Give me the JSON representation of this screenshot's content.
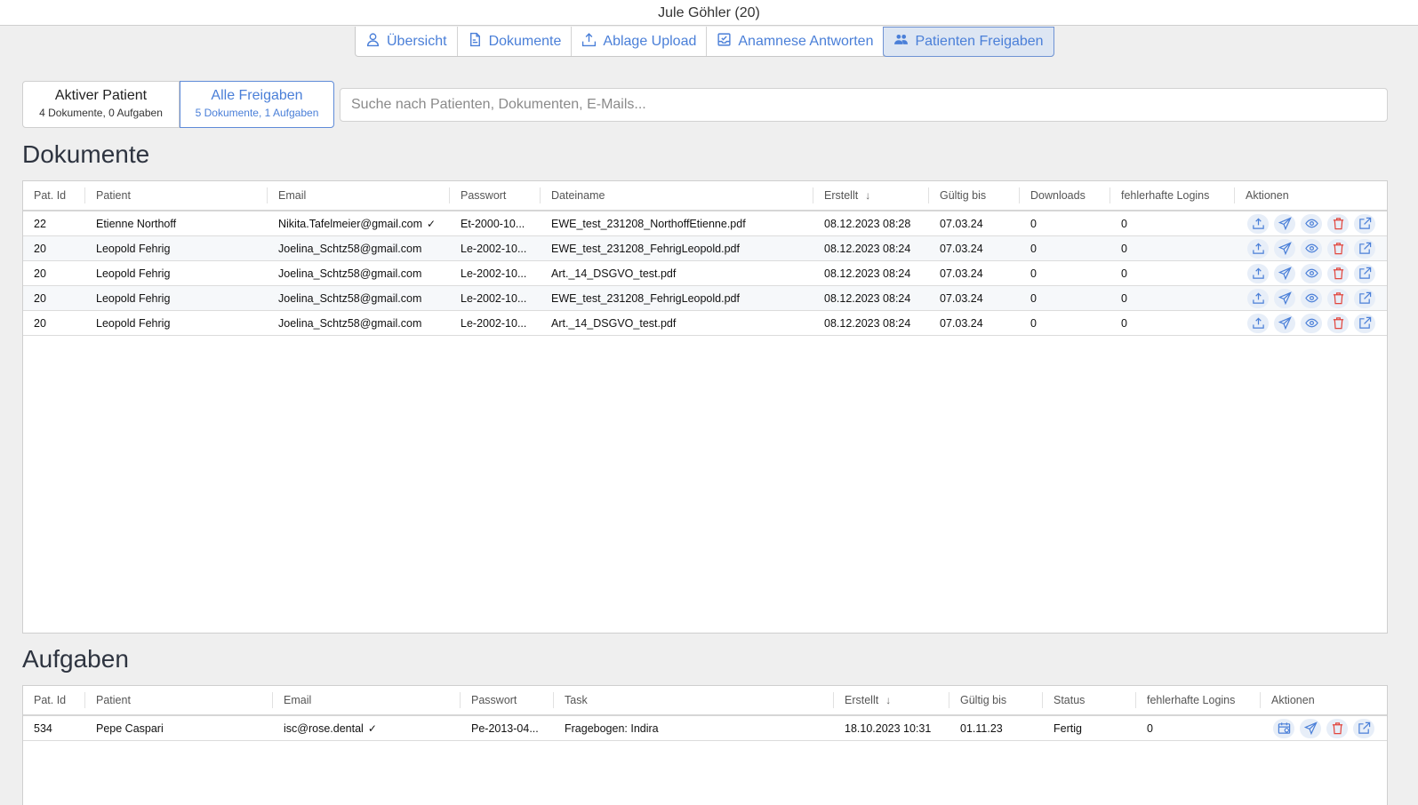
{
  "window": {
    "title": "Jule Göhler (20)"
  },
  "nav": {
    "tabs": [
      {
        "label": "Übersicht",
        "icon": "user-icon"
      },
      {
        "label": "Dokumente",
        "icon": "document-icon"
      },
      {
        "label": "Ablage Upload",
        "icon": "upload-icon"
      },
      {
        "label": "Anamnese Antworten",
        "icon": "inbox-icon"
      },
      {
        "label": "Patienten Freigaben",
        "icon": "users-icon",
        "active": true
      }
    ]
  },
  "scope": {
    "active_patient": {
      "title": "Aktiver Patient",
      "subtitle": "4 Dokumente, 0 Aufgaben"
    },
    "all_shares": {
      "title": "Alle Freigaben",
      "subtitle": "5 Dokumente, 1 Aufgaben",
      "selected": true
    }
  },
  "search": {
    "placeholder": "Suche nach Patienten, Dokumenten, E-Mails...",
    "value": ""
  },
  "documents": {
    "title": "Dokumente",
    "columns": [
      "Pat. Id",
      "Patient",
      "Email",
      "Passwort",
      "Dateiname",
      "Erstellt",
      "Gültig bis",
      "Downloads",
      "fehlerhafte Logins",
      "Aktionen"
    ],
    "sort_column": "Erstellt",
    "sort_direction": "descending",
    "rows": [
      {
        "pat_id": "22",
        "patient": "Etienne Northoff",
        "email": "Nikita.Tafelmeier@gmail.com",
        "verified": true,
        "password": "Et-2000-10...",
        "filename": "EWE_test_231208_NorthoffEtienne.pdf",
        "created": "08.12.2023 08:28",
        "valid_until": "07.03.24",
        "downloads": "0",
        "failed_logins": "0"
      },
      {
        "pat_id": "20",
        "patient": "Leopold Fehrig",
        "email": "Joelina_Schtz58@gmail.com",
        "verified": false,
        "password": "Le-2002-10...",
        "filename": "EWE_test_231208_FehrigLeopold.pdf",
        "created": "08.12.2023 08:24",
        "valid_until": "07.03.24",
        "downloads": "0",
        "failed_logins": "0"
      },
      {
        "pat_id": "20",
        "patient": "Leopold Fehrig",
        "email": "Joelina_Schtz58@gmail.com",
        "verified": false,
        "password": "Le-2002-10...",
        "filename": "Art._14_DSGVO_test.pdf",
        "created": "08.12.2023 08:24",
        "valid_until": "07.03.24",
        "downloads": "0",
        "failed_logins": "0"
      },
      {
        "pat_id": "20",
        "patient": "Leopold Fehrig",
        "email": "Joelina_Schtz58@gmail.com",
        "verified": false,
        "password": "Le-2002-10...",
        "filename": "EWE_test_231208_FehrigLeopold.pdf",
        "created": "08.12.2023 08:24",
        "valid_until": "07.03.24",
        "downloads": "0",
        "failed_logins": "0"
      },
      {
        "pat_id": "20",
        "patient": "Leopold Fehrig",
        "email": "Joelina_Schtz58@gmail.com",
        "verified": false,
        "password": "Le-2002-10...",
        "filename": "Art._14_DSGVO_test.pdf",
        "created": "08.12.2023 08:24",
        "valid_until": "07.03.24",
        "downloads": "0",
        "failed_logins": "0"
      }
    ],
    "row_actions": [
      "upload-icon",
      "send-icon",
      "eye-icon",
      "trash-icon",
      "external-link-icon"
    ]
  },
  "tasks": {
    "title": "Aufgaben",
    "columns": [
      "Pat. Id",
      "Patient",
      "Email",
      "Passwort",
      "Task",
      "Erstellt",
      "Gültig bis",
      "Status",
      "fehlerhafte Logins",
      "Aktionen"
    ],
    "sort_column": "Erstellt",
    "sort_direction": "descending",
    "rows": [
      {
        "pat_id": "534",
        "patient": "Pepe Caspari",
        "email": "isc@rose.dental",
        "verified": true,
        "password": "Pe-2013-04...",
        "task": "Fragebogen: Indira",
        "created": "18.10.2023 10:31",
        "valid_until": "01.11.23",
        "status": "Fertig",
        "failed_logins": "0"
      }
    ],
    "row_actions": [
      "calendar-icon",
      "send-icon",
      "trash-icon",
      "external-link-icon"
    ]
  },
  "colors": {
    "accent": "#4a7fd8",
    "danger": "#e2453c",
    "active_tab_bg": "#dde6f3",
    "page_bg": "#efefef"
  }
}
